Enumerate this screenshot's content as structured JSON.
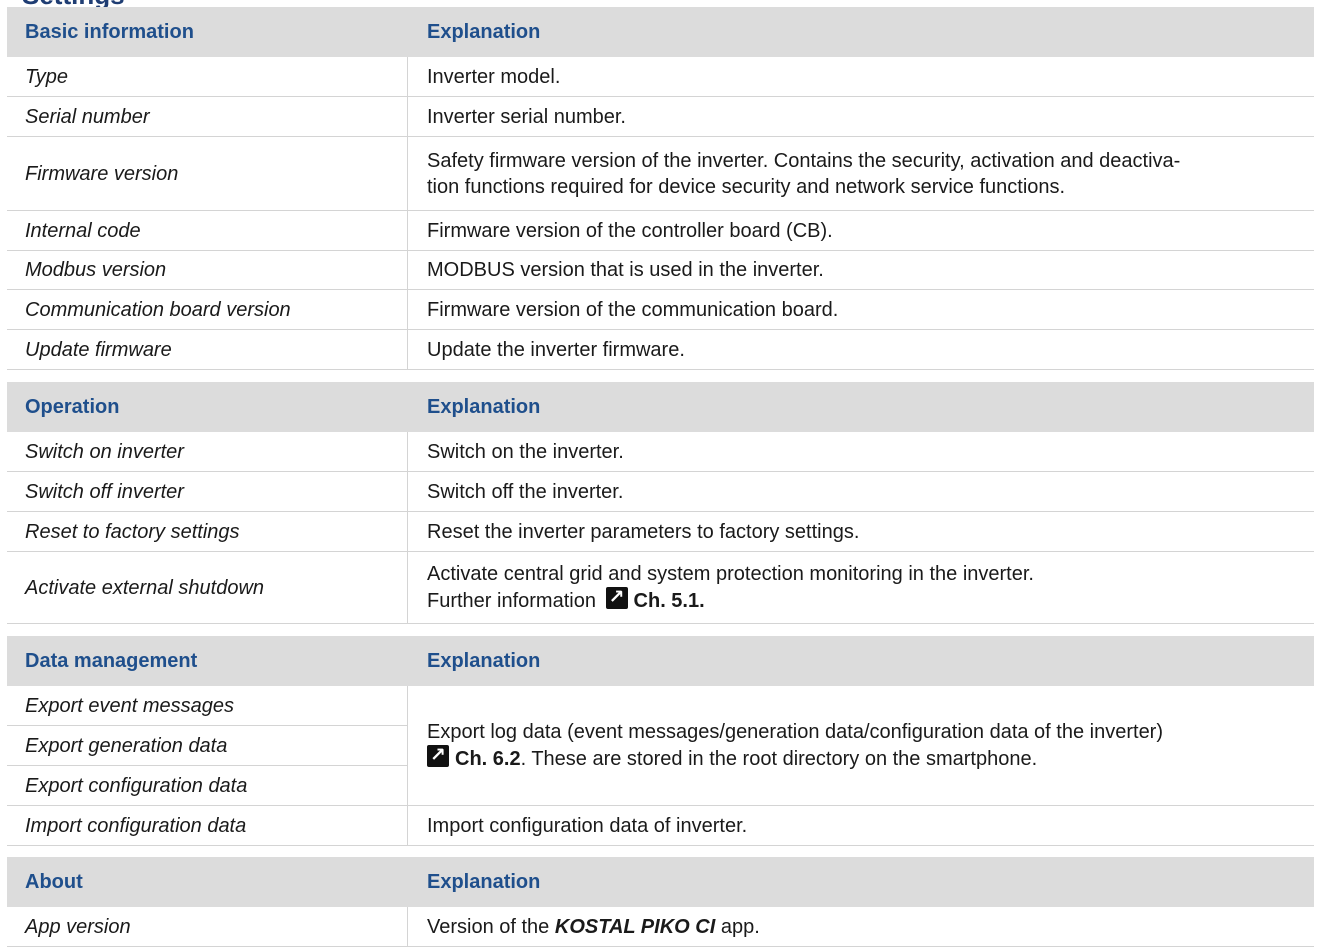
{
  "page_heading": "Settings",
  "basic": {
    "header_left": "Basic information",
    "header_right": "Explanation",
    "rows": [
      {
        "term": "Type",
        "desc": "Inverter model."
      },
      {
        "term": "Serial number",
        "desc": "Inverter serial number."
      },
      {
        "term": "Firmware version",
        "desc_line1": "Safety firmware version of the inverter. Contains the security, activation and deactiva-",
        "desc_line2": "tion functions required for device security and network service functions."
      },
      {
        "term": "Internal code",
        "desc": "Firmware version of the controller board (CB)."
      },
      {
        "term": "Modbus version",
        "desc": "MODBUS version that is used in the inverter."
      },
      {
        "term": "Communication board version",
        "desc": "Firmware version of the communication board."
      },
      {
        "term": "Update firmware",
        "desc": "Update the inverter firmware."
      }
    ]
  },
  "operation": {
    "header_left": "Operation",
    "header_right": "Explanation",
    "rows": [
      {
        "term": "Switch on inverter",
        "desc": "Switch on the inverter."
      },
      {
        "term": "Switch off inverter",
        "desc": "Switch off the inverter."
      },
      {
        "term": "Reset to factory settings",
        "desc": "Reset the inverter parameters to factory settings."
      },
      {
        "term": "Activate external shutdown",
        "desc_line1": "Activate central grid and system protection monitoring in the inverter.",
        "desc_line2_prefix": "Further information",
        "desc_line2_ref": "Ch. 5.1."
      }
    ]
  },
  "data_management": {
    "header_left": "Data management",
    "header_right": "Explanation",
    "rows": [
      {
        "term": "Export event messages"
      },
      {
        "term": "Export generation data"
      },
      {
        "term": "Export configuration data"
      },
      {
        "term": "Import configuration data",
        "desc": "Import configuration data of inverter."
      }
    ],
    "merged_desc_line1": "Export log data (event messages/generation data/configuration data of the inverter)",
    "merged_desc_ref": "Ch. 6.2",
    "merged_desc_line2_suffix": ". These are stored in the root directory on the smartphone."
  },
  "about": {
    "header_left": "About",
    "header_right": "Explanation",
    "rows": [
      {
        "term": "App version",
        "desc_prefix": "Version of the ",
        "desc_bold": "KOSTAL PIKO CI",
        "desc_suffix": " app."
      }
    ]
  },
  "ref_icon_glyph": "↗",
  "colors": {
    "header_bg": "#dcdcdc",
    "header_text": "#1f4f8c",
    "heading": "#1f3d73"
  }
}
